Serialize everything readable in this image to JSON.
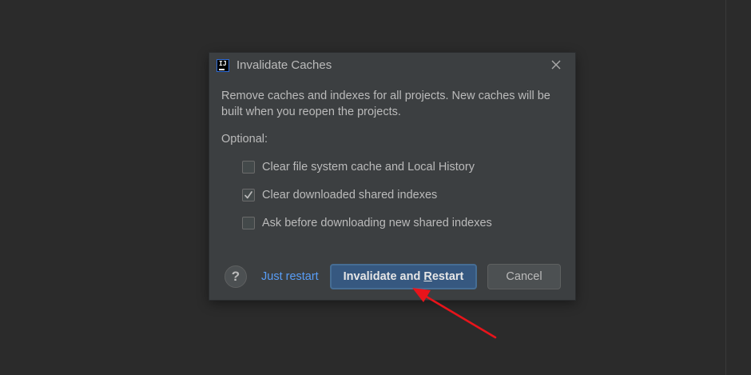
{
  "dialog": {
    "title": "Invalidate Caches",
    "app_icon": "intellij-idea-icon",
    "description": "Remove caches and indexes for all projects. New caches will be built when you reopen the projects.",
    "optional_label": "Optional:",
    "options": [
      {
        "label": "Clear file system cache and Local History",
        "checked": false
      },
      {
        "label": "Clear downloaded shared indexes",
        "checked": true
      },
      {
        "label": "Ask before downloading new shared indexes",
        "checked": false
      }
    ],
    "help_label": "?",
    "just_restart_label": "Just restart",
    "primary_button": {
      "prefix": "Invalidate and ",
      "mnemonic": "R",
      "suffix": "estart"
    },
    "cancel_label": "Cancel"
  },
  "colors": {
    "background": "#2b2b2b",
    "dialog": "#3c3f41",
    "text": "#bbbbbb",
    "link": "#589df6",
    "primary_button": "#365880",
    "annotation_arrow": "#e8141b"
  }
}
